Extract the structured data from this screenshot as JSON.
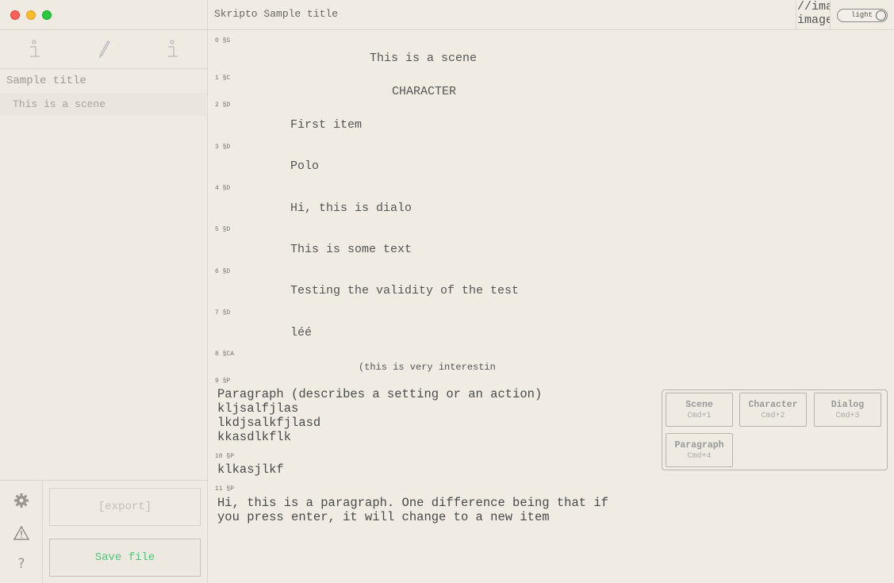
{
  "window": {
    "title": "Skripto Sample title"
  },
  "header": {
    "image_text_line1": "//ima",
    "image_text_line2": "image",
    "theme_toggle_label": "light"
  },
  "sidebar": {
    "document_title": "Sample title",
    "scenes": [
      {
        "label": "This is a scene"
      }
    ],
    "export_label": "[export]",
    "save_label": "Save file",
    "help_label": "?"
  },
  "editor": {
    "lines": [
      {
        "meta": "0 §S",
        "text": "This is a scene"
      },
      {
        "meta": "1 §C",
        "text": "CHARACTER"
      },
      {
        "meta": "2 §D",
        "text": "First item"
      },
      {
        "meta": "3 §D",
        "text": "Polo"
      },
      {
        "meta": "4 §D",
        "text": "Hi, this is dialo"
      },
      {
        "meta": "5 §D",
        "text": "This is some text"
      },
      {
        "meta": "6 §D",
        "text": "Testing the validity of the test"
      },
      {
        "meta": "7 §D",
        "text": "léé"
      },
      {
        "meta": "8 §CA",
        "text": "(this is very interestin"
      },
      {
        "meta": "9 §P",
        "text": "Paragraph (describes a setting or an action)\nkljsalfjlas\nlkdjsalkfjlasd\nkkasdlkflk"
      },
      {
        "meta": "10 §P",
        "text": "klkasjlkf"
      },
      {
        "meta": "11 §P",
        "text": "Hi, this is a paragraph. One difference being that if\nyou press enter, it will change to a new item"
      }
    ]
  },
  "picker": {
    "buttons": [
      {
        "name": "Scene",
        "shortcut": "Cmd+1"
      },
      {
        "name": "Character",
        "shortcut": "Cmd+2"
      },
      {
        "name": "Dialog",
        "shortcut": "Cmd+3"
      },
      {
        "name": "Paragraph",
        "shortcut": "Cmd+4"
      }
    ]
  },
  "colors": {
    "background": "#f0ebe3",
    "save_accent": "#4fc57a",
    "text": "#555555"
  }
}
